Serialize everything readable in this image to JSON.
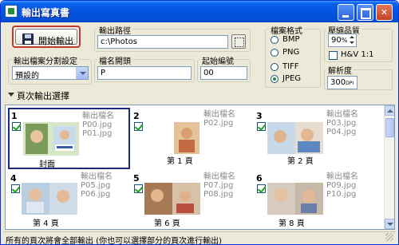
{
  "window": {
    "title": "輸出寫真書",
    "colors": {
      "titlebar": "#0454e0",
      "accent": "#c0392b",
      "selected": "#1e2a7a"
    }
  },
  "toolbar": {
    "start_label": "開始輸出"
  },
  "split": {
    "label": "輸出檔案分割設定",
    "value": "預設的"
  },
  "path": {
    "label": "輸出路徑",
    "value": "c:\\Photos"
  },
  "prefix": {
    "label": "檔名開頭",
    "value": "P"
  },
  "startnum": {
    "label": "起始編號",
    "value": "00"
  },
  "format": {
    "label": "檔案格式",
    "options": [
      "BMP",
      "PNG",
      "TIFF",
      "JPEG"
    ],
    "selected": "JPEG"
  },
  "quality": {
    "label": "壓縮品質",
    "value": "90",
    "unit": "%",
    "hv_label": "H&V 1:1"
  },
  "resolution": {
    "label": "解析度",
    "value": "300",
    "unit": "DPI"
  },
  "section": {
    "title": "頁次輸出選擇"
  },
  "pages": [
    {
      "num": "1",
      "label": "封面",
      "names_title": "輸出檔名",
      "files": [
        "P00.jpg",
        "P01.jpg"
      ],
      "selected": true
    },
    {
      "num": "2",
      "label": "第 1 頁",
      "names_title": "輸出檔名",
      "files": [
        "P02.jpg"
      ]
    },
    {
      "num": "3",
      "label": "第 2 頁",
      "names_title": "輸出檔名",
      "files": [
        "P03.jpg",
        "P04.jpg"
      ]
    },
    {
      "num": "4",
      "label": "第 4 頁",
      "names_title": "輸出檔名",
      "files": [
        "P05.jpg",
        "P06.jpg"
      ]
    },
    {
      "num": "5",
      "label": "第 6 頁",
      "names_title": "輸出檔名",
      "files": [
        "P07.jpg",
        "P08.jpg"
      ]
    },
    {
      "num": "6",
      "label": "第 8 頁",
      "names_title": "輸出檔名",
      "files": [
        "P09.jpg",
        "P10.jpg"
      ]
    }
  ],
  "status": {
    "text": "所有的頁次將會全部輸出 (你也可以選擇部分的頁次進行輸出)"
  }
}
